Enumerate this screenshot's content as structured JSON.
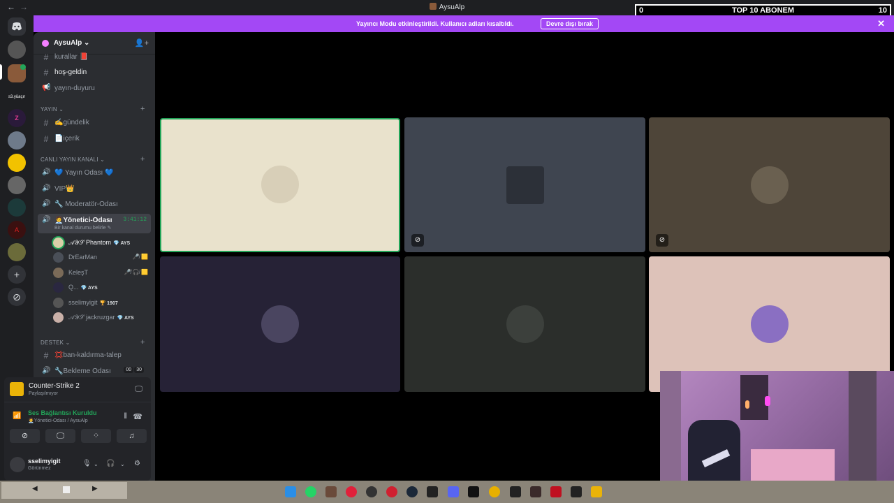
{
  "window": {
    "title": "AysuAlp",
    "nav_back": "←",
    "nav_forward": "→"
  },
  "overlay": {
    "left_value": "0",
    "center_label": "TOP 10 ABONEM",
    "right_value": "10"
  },
  "banner": {
    "message": "Yayıncı Modu etkinleştirildi. Kullanıcı adları kısaltıldı.",
    "button_label": "Devre dışı bırak",
    "close": "✕",
    "color": "#a348f5"
  },
  "guilds": {
    "folder_label": "s3.yüaçır",
    "add_label": "+",
    "explore_label": "⊘"
  },
  "server": {
    "name": "AysuAlp",
    "chevron": "⌄"
  },
  "channels": {
    "top": [
      {
        "name": "kurallar 📕",
        "icon": "#"
      },
      {
        "name": "hoş-geldin",
        "icon": "#"
      },
      {
        "name": "yayın-duyuru",
        "icon": "📢"
      }
    ],
    "yayin_category": "YAYIN",
    "yayin": [
      {
        "name": "✍️gündelik",
        "icon": "#"
      },
      {
        "name": "📄içerik",
        "icon": "#"
      }
    ],
    "canli_category": "CANLI YAYIN KANALI",
    "canli": [
      {
        "name": "💙 Yayın Odası 💙",
        "icon": "🔊"
      },
      {
        "name": "VIP👑",
        "icon": "🔊"
      },
      {
        "name": "🔧 Moderatör-Odası",
        "icon": "🔊"
      }
    ],
    "active": {
      "name": "🧑‍💼Yönetici-Odası",
      "timer": "3:41:12",
      "status": "Bir kanal durumu belirle ✎"
    },
    "voice_users": [
      {
        "name": "𝒜𝒴𝒮 Phantom",
        "tag": "💎 AYS",
        "icons": ""
      },
      {
        "name": "DrEarMan",
        "tag": "",
        "icons": "🎤̸ 🟨"
      },
      {
        "name": "KeleşT",
        "tag": "",
        "icons": "🎤̸ 🎧̸ 🟨"
      },
      {
        "name": "Q...",
        "tag": "💎 AYS",
        "icons": ""
      },
      {
        "name": "sselimyigit",
        "tag": "🏆 1907",
        "icons": ""
      },
      {
        "name": "𝒜𝒴𝒮 jackruzgar",
        "tag": "💎 AYS",
        "icons": ""
      }
    ],
    "destek_category": "DESTEK",
    "destek": [
      {
        "name": "💢ban-kaldırma-talep",
        "icon": "#"
      },
      {
        "name": "🔧Bekleme Odası",
        "icon": "🔊",
        "count_a": "00",
        "count_b": "30"
      }
    ]
  },
  "panel": {
    "game_name": "Counter-Strike 2",
    "game_status": "Paylaşılmıyor",
    "voice_title": "Ses Bağlantısı Kuruldu",
    "voice_sub": "🧑‍💼Yönetici-Odası / AysuAlp",
    "username": "sselimyigit",
    "user_status": "Görünmez"
  },
  "tiles": [
    {
      "bg": "#e9e2cc",
      "muted": false,
      "speaking": true
    },
    {
      "bg": "#3f4550",
      "muted": true,
      "speaking": false
    },
    {
      "bg": "#4e4539",
      "muted": true,
      "speaking": false
    },
    {
      "bg": "#262236",
      "muted": false,
      "speaking": false
    },
    {
      "bg": "#2b2e2b",
      "muted": false,
      "speaking": false
    },
    {
      "bg": "#ddc2b9",
      "muted": false,
      "speaking": false
    }
  ],
  "colors": {
    "discord_bg": "#1e1f22",
    "sidebar": "#2b2d31",
    "green": "#23a559"
  }
}
